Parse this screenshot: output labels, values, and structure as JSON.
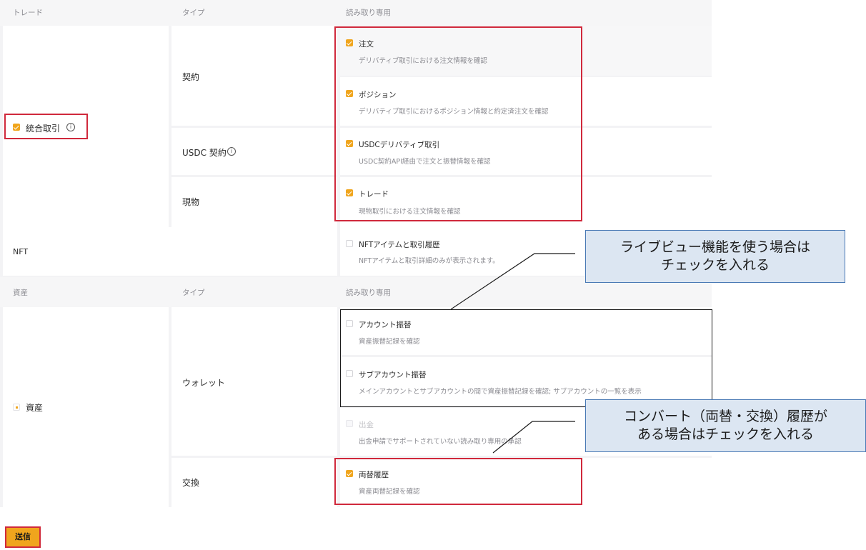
{
  "trade_header": {
    "col1": "トレード",
    "col2": "タイプ",
    "col3": "読み取り専用"
  },
  "trade": {
    "group_label": "統合取引",
    "group_info": "i",
    "rows": [
      {
        "type": "契約",
        "options": [
          {
            "title": "注文",
            "desc": "デリバティブ取引における注文情報を確認",
            "checked": true
          },
          {
            "title": "ポジション",
            "desc": "デリバティブ取引におけるポジション情報と約定済注文を確認",
            "checked": true
          }
        ]
      },
      {
        "type": "USDC 契約",
        "info": "i",
        "options": [
          {
            "title": "USDCデリバティブ取引",
            "desc": "USDC契約API経由で注文と振替情報を確認",
            "checked": true
          }
        ]
      },
      {
        "type": "現物",
        "options": [
          {
            "title": "トレード",
            "desc": "現物取引における注文情報を確認",
            "checked": true
          }
        ]
      }
    ]
  },
  "nft": {
    "label": "NFT",
    "option": {
      "title": "NFTアイテムと取引履歴",
      "desc": "NFTアイテムと取引詳細のみが表示されます。",
      "checked": false
    }
  },
  "assets_header": {
    "col1": "資産",
    "col2": "タイプ",
    "col3": "読み取り専用"
  },
  "assets": {
    "group_label": "資産",
    "rows": [
      {
        "type": "ウォレット",
        "options": [
          {
            "title": "アカウント振替",
            "desc": "資産振替記録を確認",
            "checked": false
          },
          {
            "title": "サブアカウント振替",
            "desc": "メインアカウントとサブアカウントの間で資産振替記録を確認; サブアカウントの一覧を表示",
            "checked": false
          },
          {
            "title": "出金",
            "desc": "出金申請でサポートされていない読み取り専用の承認",
            "checked": false,
            "disabled": true
          }
        ]
      },
      {
        "type": "交換",
        "options": [
          {
            "title": "両替履歴",
            "desc": "資産両替記録を確認",
            "checked": true
          }
        ]
      }
    ]
  },
  "submit_label": "送信",
  "callouts": {
    "live_view": {
      "line1": "ライブビュー機能を使う場合は",
      "line2": "チェックを入れる"
    },
    "convert": {
      "line1": "コンバート（両替・交換）履歴が",
      "line2": "ある場合はチェックを入れる"
    }
  },
  "colors": {
    "accent": "#f0a51d",
    "highlight_red": "#d0293c",
    "callout_fill": "#dce6f2",
    "callout_border": "#4a7ab5"
  }
}
